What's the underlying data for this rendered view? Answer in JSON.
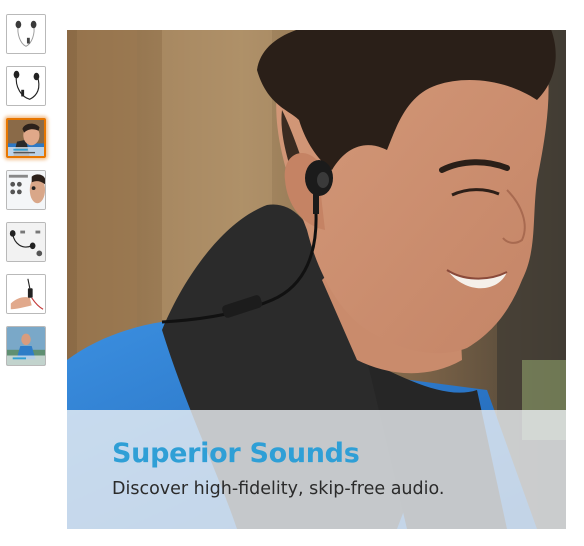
{
  "gallery": {
    "thumbnails": [
      {
        "icon": "earbuds-white-thumbnail",
        "selected": false
      },
      {
        "icon": "earbuds-black-thumbnail",
        "selected": false
      },
      {
        "icon": "man-wearing-earbuds-thumbnail",
        "selected": true
      },
      {
        "icon": "earbud-fit-diagram-thumbnail",
        "selected": false
      },
      {
        "icon": "earbuds-accessories-thumbnail",
        "selected": false
      },
      {
        "icon": "hand-holding-remote-thumbnail",
        "selected": false
      },
      {
        "icon": "athlete-running-thumbnail",
        "selected": false
      }
    ],
    "selected_border_color": "#e77600"
  },
  "main_image": {
    "caption_title": "Superior Sounds",
    "caption_subtitle": "Discover high-fidelity, skip-free audio.",
    "title_color": "#2f9fd6"
  }
}
